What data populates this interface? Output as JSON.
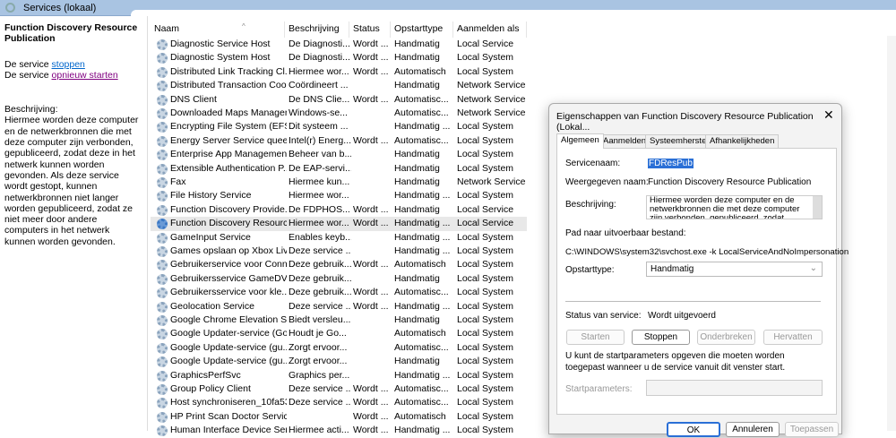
{
  "window": {
    "title": "Services (lokaal)"
  },
  "left_panel": {
    "service_title": "Function Discovery Resource Publication",
    "prefix": "De service",
    "stop_link": "stoppen",
    "restart_link": "opnieuw starten",
    "desc_label": "Beschrijving:",
    "description": "Hiermee worden deze computer en de netwerkbronnen die met deze computer zijn verbonden, gepubliceerd, zodat deze in het netwerk kunnen worden gevonden. Als deze service wordt gestopt, kunnen netwerkbronnen niet langer worden gepubliceerd, zodat ze niet meer door andere computers in het netwerk kunnen worden gevonden."
  },
  "table": {
    "columns": [
      "Naam",
      "Beschrijving",
      "Status",
      "Opstarttype",
      "Aanmelden als"
    ],
    "rows": [
      [
        "Diagnostic Service Host",
        "De Diagnosti...",
        "Wordt ...",
        "Handmatig",
        "Local Service"
      ],
      [
        "Diagnostic System Host",
        "De Diagnosti...",
        "Wordt ...",
        "Handmatig",
        "Local System"
      ],
      [
        "Distributed Link Tracking Cl...",
        "Hiermee wor...",
        "Wordt ...",
        "Automatisch",
        "Local System"
      ],
      [
        "Distributed Transaction Coo...",
        "Coördineert ...",
        "",
        "Handmatig",
        "Network Service"
      ],
      [
        "DNS Client",
        "De DNS Clie...",
        "Wordt ...",
        "Automatisc...",
        "Network Service"
      ],
      [
        "Downloaded Maps Manager",
        "Windows-se...",
        "",
        "Automatisc...",
        "Network Service"
      ],
      [
        "Encrypting File System (EFS)",
        "Dit systeem ...",
        "",
        "Handmatig ...",
        "Local System"
      ],
      [
        "Energy Server Service queen...",
        "Intel(r) Energ...",
        "Wordt ...",
        "Automatisc...",
        "Local System"
      ],
      [
        "Enterprise App Managemen...",
        "Beheer van b...",
        "",
        "Handmatig",
        "Local System"
      ],
      [
        "Extensible Authentication P...",
        "De EAP-servi...",
        "",
        "Handmatig",
        "Local System"
      ],
      [
        "Fax",
        "Hiermee kun...",
        "",
        "Handmatig",
        "Network Service"
      ],
      [
        "File History Service",
        "Hiermee wor...",
        "",
        "Handmatig ...",
        "Local System"
      ],
      [
        "Function Discovery Provide...",
        "De FDPHOS...",
        "Wordt ...",
        "Handmatig",
        "Local Service"
      ],
      [
        "Function Discovery Resourc...",
        "Hiermee wor...",
        "Wordt ...",
        "Handmatig ...",
        "Local Service"
      ],
      [
        "GameInput Service",
        "Enables keyb...",
        "",
        "Handmatig ...",
        "Local System"
      ],
      [
        "Games opslaan op Xbox Live",
        "Deze service ...",
        "",
        "Handmatig ...",
        "Local System"
      ],
      [
        "Gebruikerservice voor Conn...",
        "Deze gebruik...",
        "Wordt ...",
        "Automatisch",
        "Local System"
      ],
      [
        "Gebruikersservice GameDV...",
        "Deze gebruik...",
        "",
        "Handmatig",
        "Local System"
      ],
      [
        "Gebruikersservice voor kle...",
        "Deze gebruik...",
        "Wordt ...",
        "Automatisc...",
        "Local System"
      ],
      [
        "Geolocation Service",
        "Deze service ...",
        "Wordt ...",
        "Handmatig ...",
        "Local System"
      ],
      [
        "Google Chrome Elevation S...",
        "Biedt versleu...",
        "",
        "Handmatig",
        "Local System"
      ],
      [
        "Google Updater-service (Go...",
        "Houdt je Go...",
        "",
        "Automatisch",
        "Local System"
      ],
      [
        "Google Update-service (gu...",
        "Zorgt ervoor...",
        "",
        "Automatisc...",
        "Local System"
      ],
      [
        "Google Update-service (gu...",
        "Zorgt ervoor...",
        "",
        "Handmatig",
        "Local System"
      ],
      [
        "GraphicsPerfSvc",
        "Graphics per...",
        "",
        "Handmatig ...",
        "Local System"
      ],
      [
        "Group Policy Client",
        "Deze service ...",
        "Wordt ...",
        "Automatisc...",
        "Local System"
      ],
      [
        "Host synchroniseren_10fa53",
        "Deze service ...",
        "Wordt ...",
        "Automatisc...",
        "Local System"
      ],
      [
        "HP Print Scan Doctor Service",
        "",
        "Wordt ...",
        "Automatisch",
        "Local System"
      ],
      [
        "Human Interface Device Ser...",
        "Hiermee acti...",
        "Wordt ...",
        "Handmatig ...",
        "Local System"
      ]
    ],
    "selected_index": 13
  },
  "dialog": {
    "title": "Eigenschappen van Function Discovery Resource Publication (Lokal...",
    "close": "✕",
    "tabs": [
      "Algemeen",
      "Aanmelden",
      "Systeemherstel",
      "Afhankelijkheden"
    ],
    "service_name_label": "Servicenaam:",
    "service_name": "FDResPub",
    "display_name_label": "Weergegeven naam:",
    "display_name": "Function Discovery Resource Publication",
    "desc_label": "Beschrijving:",
    "description": "Hiermee worden deze computer en de netwerkbronnen die met deze computer zijn verbonden, gepubliceerd, zodat deze in het",
    "path_label": "Pad naar uitvoerbaar bestand:",
    "path": "C:\\WINDOWS\\system32\\svchost.exe -k LocalServiceAndNoImpersonation",
    "startup_label": "Opstarttype:",
    "startup_value": "Handmatig",
    "status_label": "Status van service:",
    "status_value": "Wordt uitgevoerd",
    "btn_start": "Starten",
    "btn_stop": "Stoppen",
    "btn_pause": "Onderbreken",
    "btn_resume": "Hervatten",
    "hint": "U kunt de startparameters opgeven die moeten worden toegepast wanneer u de service vanuit dit venster start.",
    "params_label": "Startparameters:",
    "params_value": "",
    "ok": "OK",
    "cancel": "Annuleren",
    "apply": "Toepassen"
  }
}
